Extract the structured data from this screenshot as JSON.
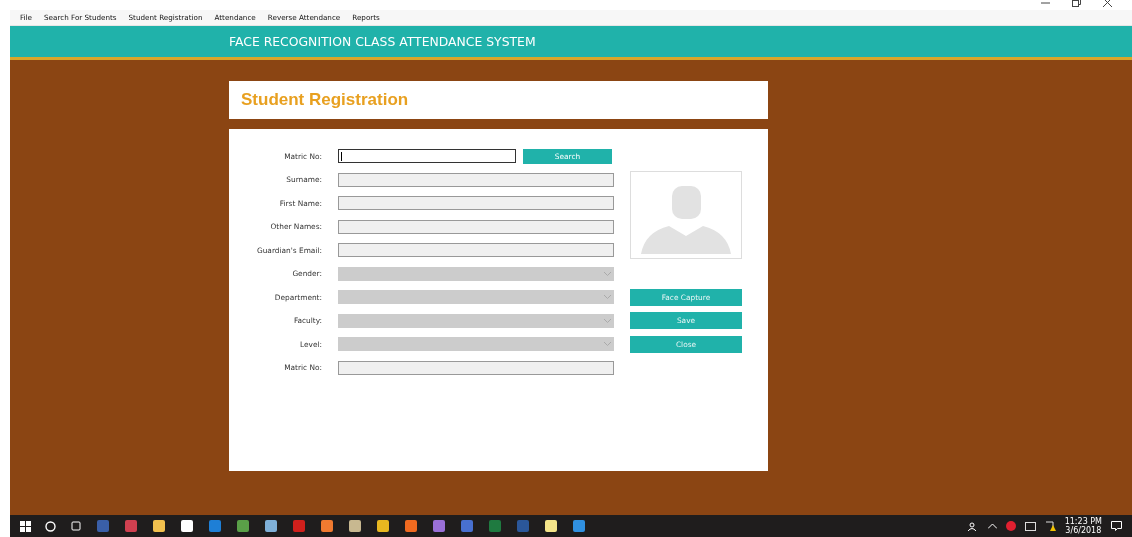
{
  "menu": [
    {
      "label": "File"
    },
    {
      "label": "Search For Students"
    },
    {
      "label": "Student Registration"
    },
    {
      "label": "Attendance"
    },
    {
      "label": "Reverse Attendance"
    },
    {
      "label": "Reports"
    }
  ],
  "header": {
    "title": "FACE RECOGNITION CLASS ATTENDANCE SYSTEM"
  },
  "page_title": "Student Registration",
  "fields": [
    {
      "label": "Matric No:",
      "kind": "text",
      "disabled": false,
      "focused": true
    },
    {
      "label": "Surname:",
      "kind": "text",
      "disabled": true,
      "focused": false
    },
    {
      "label": "First Name:",
      "kind": "text",
      "disabled": true,
      "focused": false
    },
    {
      "label": "Other Names:",
      "kind": "text",
      "disabled": true,
      "focused": false
    },
    {
      "label": "Guardian's Email:",
      "kind": "text",
      "disabled": true,
      "focused": false
    },
    {
      "label": "Gender:",
      "kind": "select",
      "disabled": true,
      "focused": false
    },
    {
      "label": "Department:",
      "kind": "select",
      "disabled": true,
      "focused": false
    },
    {
      "label": "Faculty:",
      "kind": "select",
      "disabled": true,
      "focused": false
    },
    {
      "label": "Level:",
      "kind": "select",
      "disabled": true,
      "focused": false
    },
    {
      "label": "Matric No:",
      "kind": "text",
      "disabled": true,
      "focused": false
    }
  ],
  "search_button": "Search",
  "photo": {
    "kind": "placeholder"
  },
  "buttons": [
    "Face Capture",
    "Save",
    "Close"
  ],
  "taskbar": {
    "time": "11:23 PM",
    "date": "3/6/2018"
  }
}
